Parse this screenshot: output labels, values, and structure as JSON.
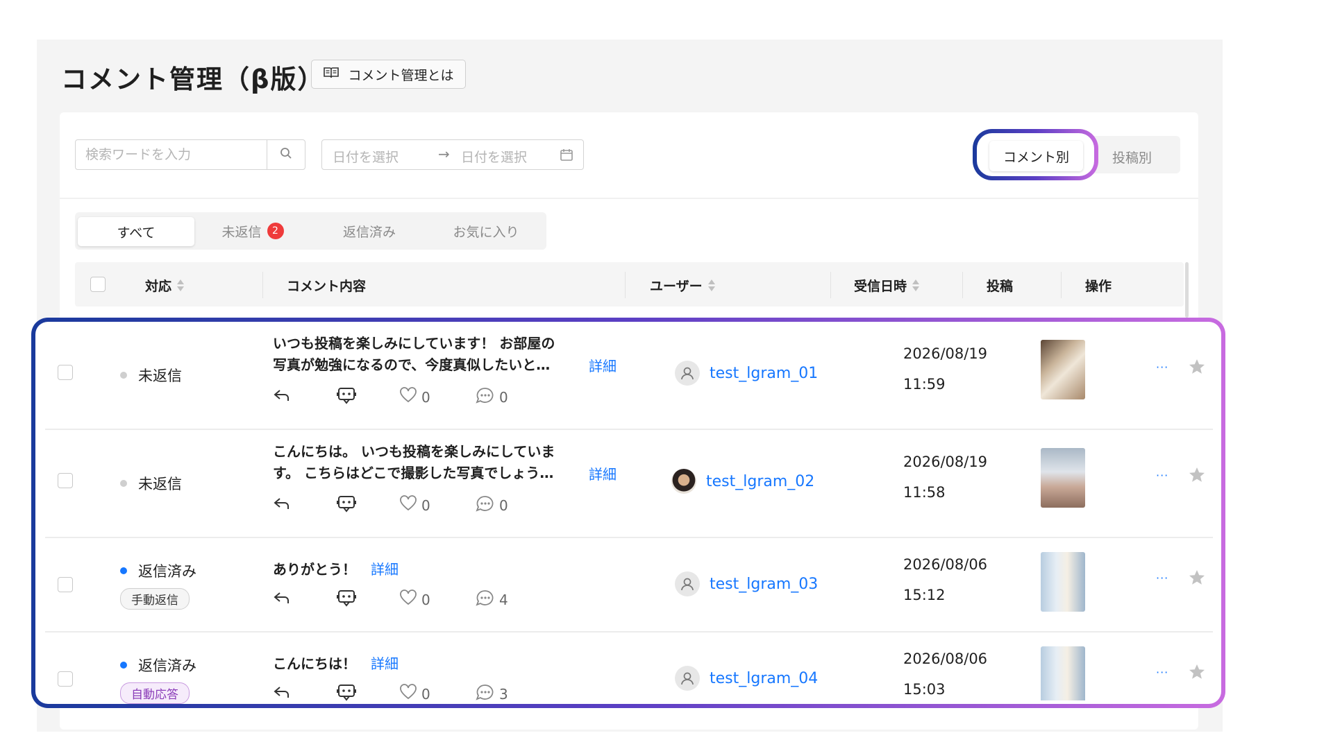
{
  "page": {
    "title": "コメント管理（β版）",
    "guide_button": "コメント管理とは"
  },
  "filters": {
    "search_placeholder": "検索ワードを入力",
    "date_start_placeholder": "日付を選択",
    "date_arrow": "→",
    "date_end_placeholder": "日付を選択"
  },
  "view_toggle": {
    "active": "コメント別",
    "other": "投稿別"
  },
  "tabs": [
    {
      "label": "すべて",
      "active": true
    },
    {
      "label": "未返信",
      "badge": "2"
    },
    {
      "label": "返信済み"
    },
    {
      "label": "お気に入り"
    }
  ],
  "table": {
    "headers": {
      "status": "対応",
      "comment": "コメント内容",
      "user": "ユーザー",
      "received": "受信日時",
      "post": "投稿",
      "actions": "操作"
    },
    "detail_label": "詳細",
    "more_label": "···",
    "rows": [
      {
        "status": "未返信",
        "comment_line1": "いつも投稿を楽しみにしています！ お部屋の",
        "comment_line2": "写真が勉強になるので、今度真似したいと…",
        "likes": "0",
        "replies": "0",
        "user": "test_lgram_01",
        "date": "2026/08/19",
        "time": "11:59"
      },
      {
        "status": "未返信",
        "comment_line1": "こんにちは。 いつも投稿を楽しみにしていま",
        "comment_line2": "す。 こちらはどこで撮影した写真でしょう…",
        "likes": "0",
        "replies": "0",
        "user": "test_lgram_02",
        "date": "2026/08/19",
        "time": "11:58"
      },
      {
        "status": "返信済み",
        "tag": "手動返信",
        "comment_line1": "ありがとう！",
        "likes": "0",
        "replies": "4",
        "user": "test_lgram_03",
        "date": "2026/08/06",
        "time": "15:12"
      },
      {
        "status": "返信済み",
        "tag": "自動応答",
        "comment_line1": "こんにちは！",
        "likes": "0",
        "replies": "3",
        "user": "test_lgram_04",
        "date": "2026/08/06",
        "time": "15:03"
      }
    ]
  },
  "colors": {
    "accent_blue": "#1677ff",
    "badge_red": "#ef3b3b",
    "unreplied_dot": "#cfcfcf",
    "replied_dot": "#1677ff",
    "highlight_start": "#1a3a9c",
    "highlight_end": "#c86be0"
  }
}
